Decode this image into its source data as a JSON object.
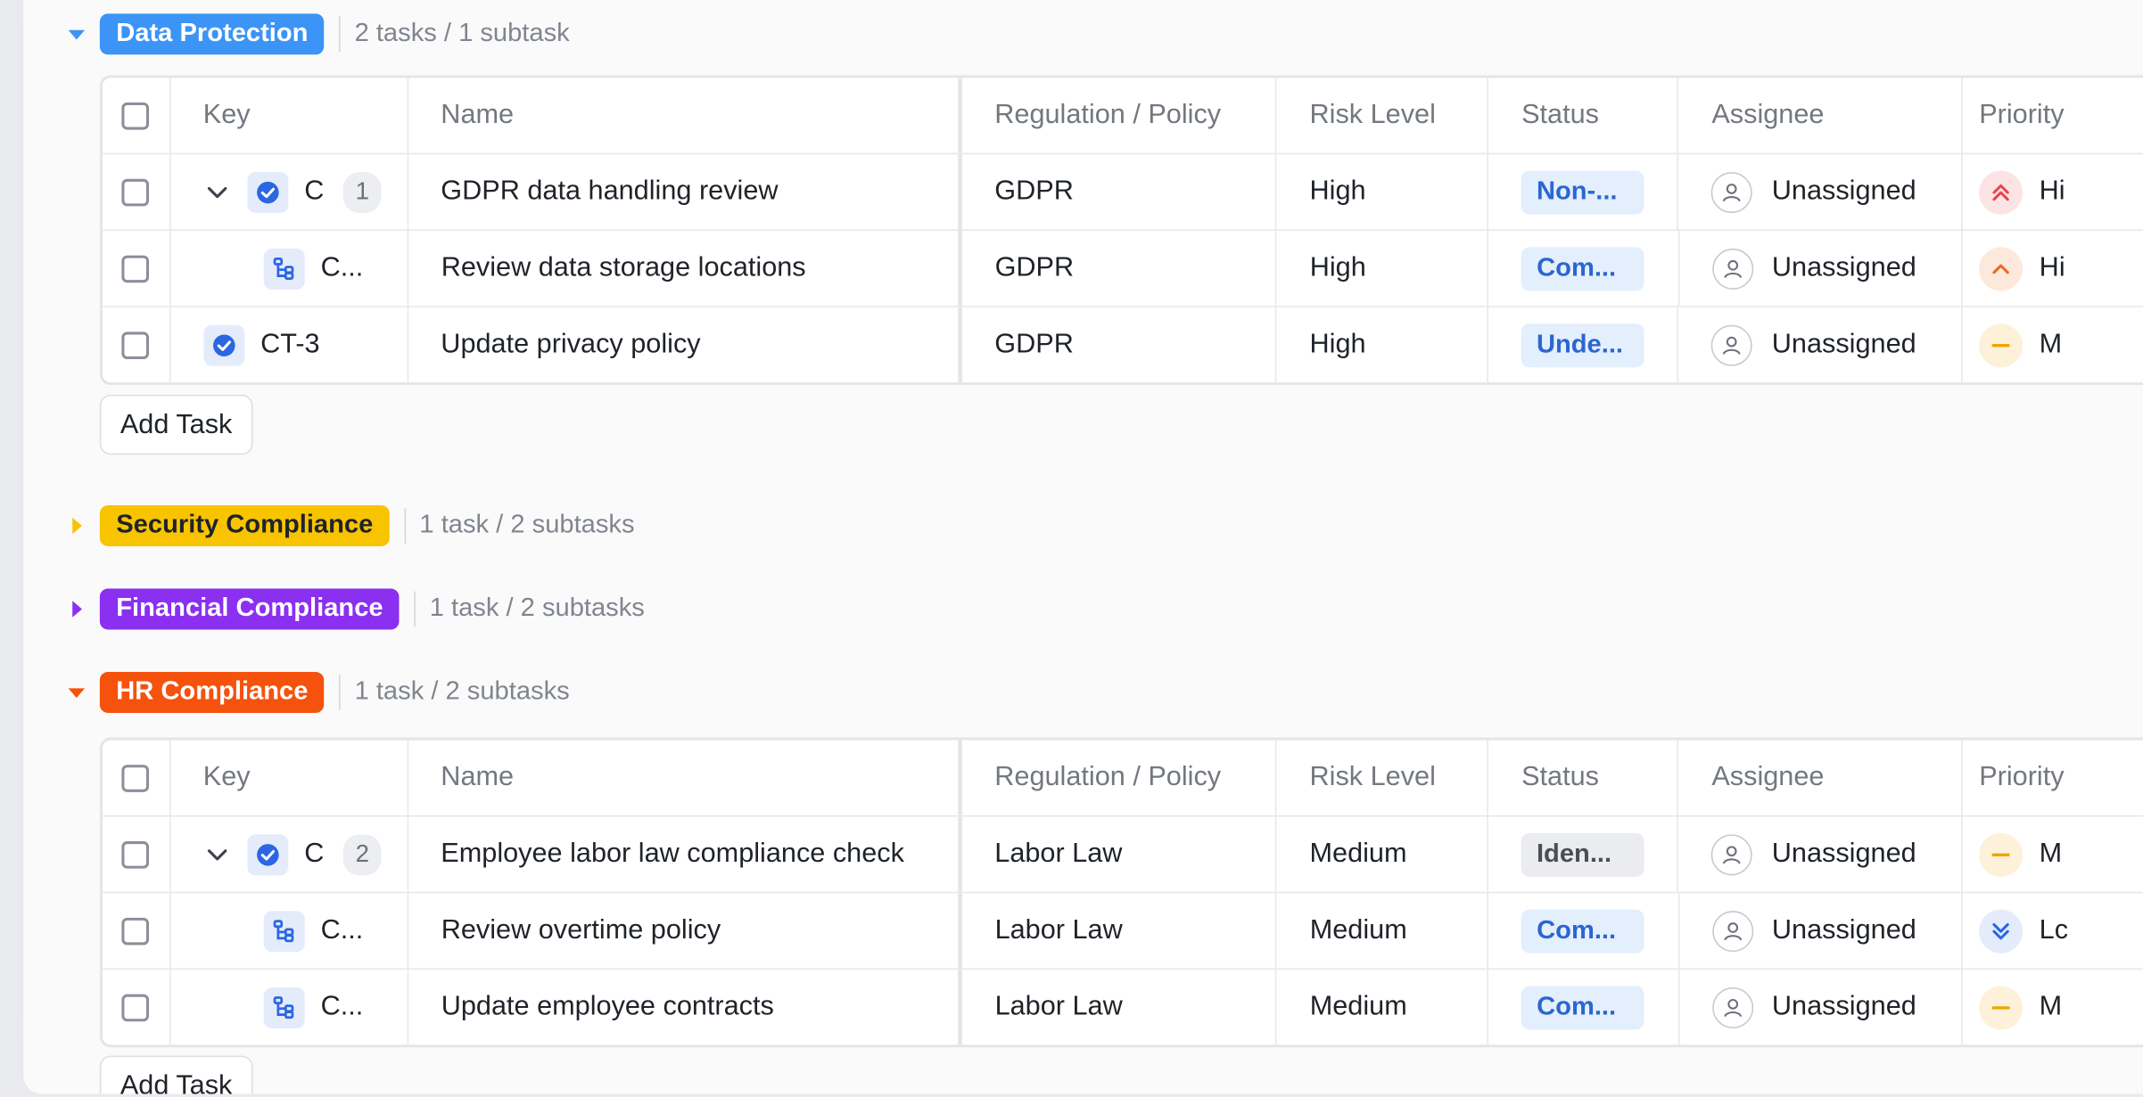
{
  "colors": {
    "data_protection": "#3b94f6",
    "security_compliance": "#f8c400",
    "financial_compliance": "#8b2ff0",
    "hr_compliance": "#f5520e",
    "status_blue": "#2b66d0"
  },
  "columns": {
    "key": "Key",
    "name": "Name",
    "regulation": "Regulation / Policy",
    "risk": "Risk Level",
    "status": "Status",
    "assignee": "Assignee",
    "priority": "Priority"
  },
  "add_task_label": "Add Task",
  "groups": [
    {
      "label": "Data Protection",
      "count": "2 tasks / 1 subtask",
      "expanded": true,
      "rows": [
        {
          "key": "C",
          "subtasks": "1",
          "name": "GDPR data handling review",
          "regulation": "GDPR",
          "risk": "High",
          "status": "Non-...",
          "assignee": "Unassigned",
          "priority": "Hi",
          "priority_icon": "highest-priority-icon"
        },
        {
          "key": "C...",
          "name": "Review data storage locations",
          "regulation": "GDPR",
          "risk": "High",
          "status": "Com...",
          "assignee": "Unassigned",
          "priority": "Hi",
          "priority_icon": "high-priority-icon"
        },
        {
          "key": "CT-3",
          "name": "Update privacy policy",
          "regulation": "GDPR",
          "risk": "High",
          "status": "Unde...",
          "assignee": "Unassigned",
          "priority": "M",
          "priority_icon": "medium-priority-icon"
        }
      ]
    },
    {
      "label": "Security Compliance",
      "count": "1 task / 2 subtasks",
      "expanded": false
    },
    {
      "label": "Financial Compliance",
      "count": "1 task / 2 subtasks",
      "expanded": false
    },
    {
      "label": "HR Compliance",
      "count": "1 task / 2 subtasks",
      "expanded": true,
      "rows": [
        {
          "key": "C",
          "subtasks": "2",
          "name": "Employee labor law compliance check",
          "regulation": "Labor Law",
          "risk": "Medium",
          "status": "Iden...",
          "assignee": "Unassigned",
          "priority": "M",
          "priority_icon": "medium-priority-icon"
        },
        {
          "key": "C...",
          "name": "Review overtime policy",
          "regulation": "Labor Law",
          "risk": "Medium",
          "status": "Com...",
          "assignee": "Unassigned",
          "priority": "Lc",
          "priority_icon": "lowest-priority-icon"
        },
        {
          "key": "C...",
          "name": "Update employee contracts",
          "regulation": "Labor Law",
          "risk": "Medium",
          "status": "Com...",
          "assignee": "Unassigned",
          "priority": "M",
          "priority_icon": "medium-priority-icon"
        }
      ]
    }
  ]
}
